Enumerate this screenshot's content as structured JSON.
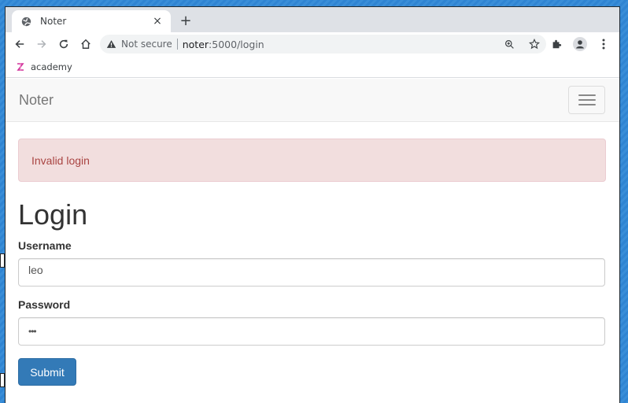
{
  "browser": {
    "tab_title": "Noter",
    "tab_close": "×",
    "new_tab": "+",
    "security_label": "Not secure",
    "url_host": "noter",
    "url_rest": ":5000/login",
    "bookmark_label": "academy"
  },
  "navbar": {
    "brand": "Noter"
  },
  "alert": {
    "message": "Invalid login",
    "background": "#f2dede",
    "text_color": "#a94442"
  },
  "form": {
    "title": "Login",
    "username_label": "Username",
    "username_value": "leo",
    "password_label": "Password",
    "password_masked": "•••",
    "submit_label": "Submit",
    "submit_color": "#337ab7"
  },
  "icons": [
    "globe-icon",
    "close-icon",
    "plus-icon",
    "back-arrow-icon",
    "forward-arrow-icon",
    "reload-icon",
    "home-icon",
    "warning-icon",
    "zoom-icon",
    "star-icon",
    "extensions-icon",
    "profile-icon",
    "menu-dots-icon",
    "bookmark-favicon",
    "hamburger-icon"
  ]
}
